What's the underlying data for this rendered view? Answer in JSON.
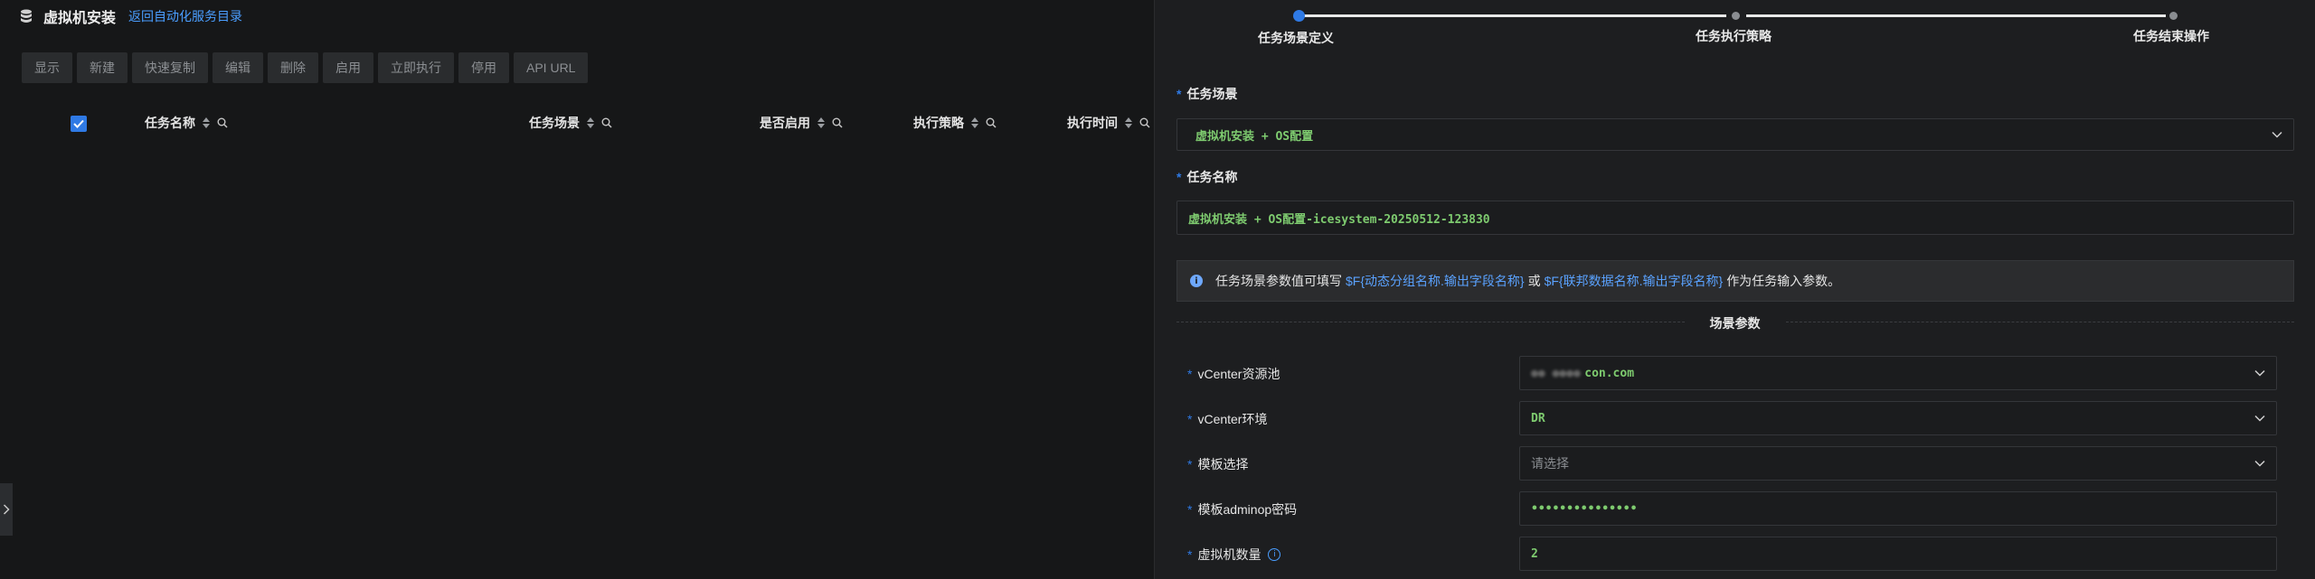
{
  "header": {
    "title": "虚拟机安装",
    "back_link": "返回自动化服务目录"
  },
  "toolbar": {
    "buttons": [
      "显示",
      "新建",
      "快速复制",
      "编辑",
      "删除",
      "启用",
      "立即执行",
      "停用",
      "API URL"
    ]
  },
  "table": {
    "columns": [
      "任务名称",
      "任务场景",
      "是否启用",
      "执行策略",
      "执行时间"
    ]
  },
  "steps": [
    "任务场景定义",
    "任务执行策略",
    "任务结束操作"
  ],
  "form": {
    "scene_label": "任务场景",
    "scene_value": "虚拟机安装 + OS配置",
    "name_label": "任务名称",
    "name_value": "虚拟机安装 + OS配置-icesystem-20250512-123830",
    "info": {
      "prefix": "任务场景参数值可填写",
      "var1": "$F{动态分组名称.输出字段名称}",
      "mid": "或",
      "var2": "$F{联邦数据名称.输出字段名称}",
      "suffix": "作为任务输入参数。"
    },
    "section_title": "场景参数",
    "params": [
      {
        "label": "vCenter资源池",
        "value": "con.com"
      },
      {
        "label": "vCenter环境",
        "value": "DR"
      },
      {
        "label": "模板选择",
        "placeholder": "请选择"
      },
      {
        "label": "模板adminop密码",
        "value": "•••••••••••••••"
      },
      {
        "label": "虚拟机数量",
        "value": "2"
      }
    ]
  },
  "colors": {
    "accent": "#2f7ae5",
    "link": "#4a9eff",
    "value_green": "#7ecb6f"
  }
}
